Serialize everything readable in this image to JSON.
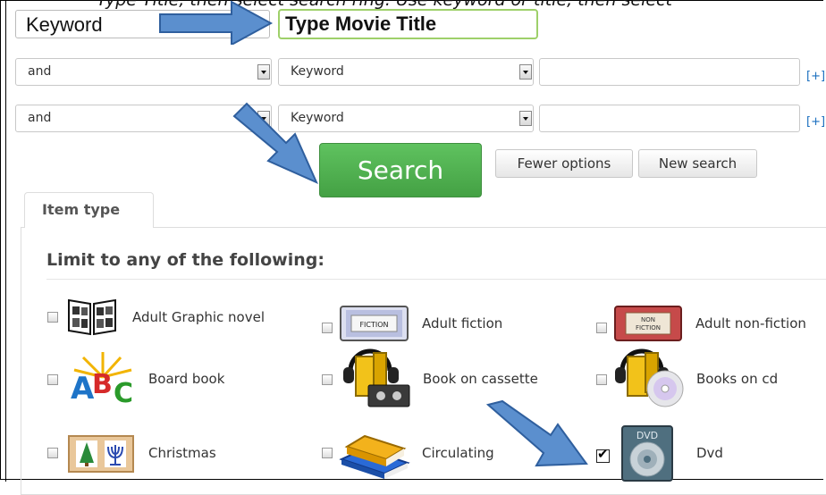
{
  "banner": {
    "text": "Type Title, then select search ring. Use keyword or title, then select"
  },
  "search": {
    "field_type": "Keyword",
    "query_value": "Type Movie Title",
    "rows": [
      {
        "operator": "and",
        "field": "Keyword",
        "value": "",
        "plus": "[+]"
      },
      {
        "operator": "and",
        "field": "Keyword",
        "value": "",
        "plus": "[+]"
      }
    ]
  },
  "buttons": {
    "search": "Search",
    "fewer_options": "Fewer options",
    "new_search": "New search"
  },
  "tabs": {
    "item_type": "Item type"
  },
  "panel": {
    "legend": "Limit to any of the following:"
  },
  "item_types": [
    {
      "label": "Adult Graphic novel",
      "icon": "graphic-novel-icon",
      "checked": false
    },
    {
      "label": "Adult fiction",
      "icon": "fiction-book-icon",
      "checked": false
    },
    {
      "label": "Adult non-fiction",
      "icon": "nonfiction-book-icon",
      "checked": false
    },
    {
      "label": "Board book",
      "icon": "abc-blocks-icon",
      "checked": false
    },
    {
      "label": "Book on cassette",
      "icon": "book-cassette-icon",
      "checked": false
    },
    {
      "label": "Books on cd",
      "icon": "book-cd-icon",
      "checked": false
    },
    {
      "label": "Christmas",
      "icon": "christmas-tree-icon",
      "checked": false
    },
    {
      "label": "Circulating",
      "icon": "stacked-books-icon",
      "checked": false
    },
    {
      "label": "Dvd",
      "icon": "dvd-icon",
      "checked": true
    }
  ],
  "colors": {
    "accent_green": "#4cae4c",
    "arrow_blue": "#5b8fce",
    "link_blue": "#1a6fbf"
  }
}
